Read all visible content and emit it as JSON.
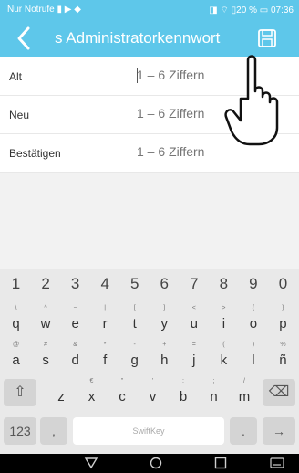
{
  "status_bar": {
    "left_text": "Nur Notrufe ▮ ▶ ◆",
    "right_text": "◨ ⌔ ▯20 % ▭ 07:36"
  },
  "app_bar": {
    "title": "s Administratorkennwort",
    "back_icon": "chevron-left-icon",
    "save_icon": "save-icon",
    "color": "#5ec7ea"
  },
  "form": {
    "rows": [
      {
        "label": "Alt",
        "placeholder": "1 – 6 Ziffern"
      },
      {
        "label": "Neu",
        "placeholder": "1 – 6 Ziffern"
      },
      {
        "label": "Bestätigen",
        "placeholder": "1 – 6 Ziffern"
      }
    ]
  },
  "keyboard": {
    "numbers": [
      "1",
      "2",
      "3",
      "4",
      "5",
      "6",
      "7",
      "8",
      "9",
      "0"
    ],
    "row1": [
      {
        "sub": "\\",
        "main": "q"
      },
      {
        "sub": "^",
        "main": "w"
      },
      {
        "sub": "~",
        "main": "e"
      },
      {
        "sub": "|",
        "main": "r"
      },
      {
        "sub": "[",
        "main": "t"
      },
      {
        "sub": "]",
        "main": "y"
      },
      {
        "sub": "<",
        "main": "u"
      },
      {
        "sub": ">",
        "main": "i"
      },
      {
        "sub": "{",
        "main": "o"
      },
      {
        "sub": "}",
        "main": "p"
      }
    ],
    "row2": [
      {
        "sub": "@",
        "main": "a"
      },
      {
        "sub": "#",
        "main": "s"
      },
      {
        "sub": "&",
        "main": "d"
      },
      {
        "sub": "*",
        "main": "f"
      },
      {
        "sub": "-",
        "main": "g"
      },
      {
        "sub": "+",
        "main": "h"
      },
      {
        "sub": "=",
        "main": "j"
      },
      {
        "sub": "(",
        "main": "k"
      },
      {
        "sub": ")",
        "main": "l"
      },
      {
        "sub": "%",
        "main": "ñ"
      }
    ],
    "row3": [
      {
        "sub": "_",
        "main": "z"
      },
      {
        "sub": "€",
        "main": "x"
      },
      {
        "sub": "\"",
        "main": "c"
      },
      {
        "sub": "'",
        "main": "v"
      },
      {
        "sub": ":",
        "main": "b"
      },
      {
        "sub": ";",
        "main": "n"
      },
      {
        "sub": "/",
        "main": "m"
      }
    ],
    "shift_label": "⇧",
    "backspace_label": "⌫",
    "symbols_label": "123",
    "comma_label": ",",
    "mic_label": "🎙",
    "space_label": "SwiftKey",
    "period_label": ".",
    "enter_label": "→"
  },
  "nav_bar": {
    "back_icon": "triangle-back-icon",
    "home_icon": "circle-home-icon",
    "recents_icon": "square-recents-icon",
    "keyboard_icon": "keyboard-icon"
  }
}
